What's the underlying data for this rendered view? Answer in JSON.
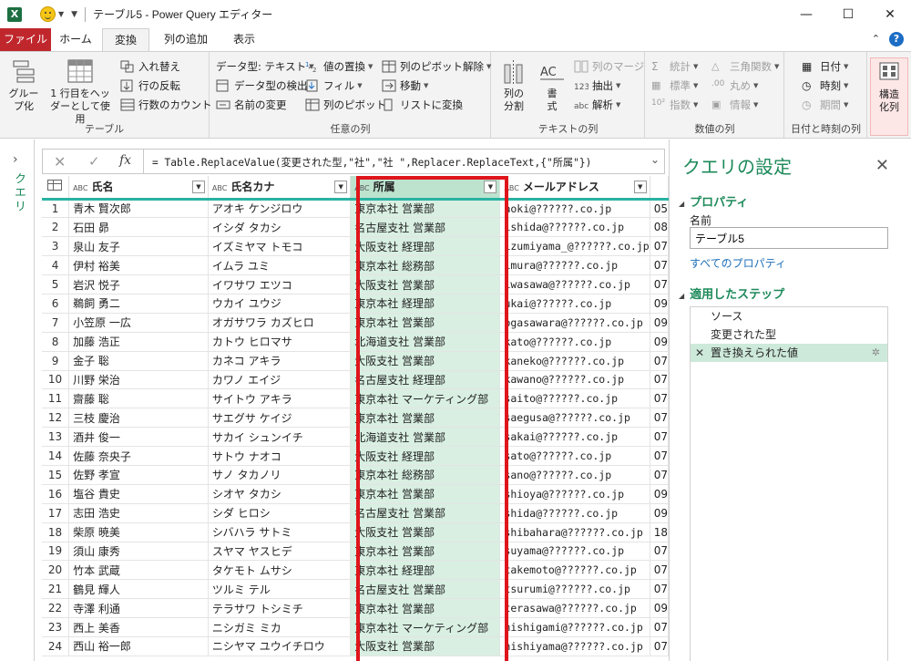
{
  "window": {
    "app_icon": "X",
    "title": "テーブル5 - Power Query エディター",
    "controls": [
      "—",
      "☐",
      "✕"
    ]
  },
  "ribbon_tabs": [
    "ファイル",
    "ホーム",
    "変換",
    "列の追加",
    "表示"
  ],
  "ribbon": {
    "table_group": {
      "label": "テーブル",
      "group_by_1": "グルー",
      "group_by_2": "プ化",
      "use_first_row_1": "1 行目をヘッ",
      "use_first_row_2": "ダーとして使用",
      "transpose": "入れ替え",
      "reverse_rows": "行の反転",
      "count_rows": "行数のカウント"
    },
    "any_column_group": {
      "label": "任意の列",
      "data_type": "データ型: テキスト",
      "detect_type": "データ型の検出",
      "rename": "名前の変更",
      "replace_values": "値の置換",
      "fill": "フィル",
      "pivot": "列のピボット",
      "unpivot": "列のピボット解除",
      "move": "移動",
      "to_list": "リストに変換"
    },
    "text_group": {
      "label": "テキストの列",
      "split_1": "列の",
      "split_2": "分割",
      "format_1": "書",
      "format_2": "式",
      "merge": "列のマージ",
      "extract": "抽出",
      "parse": "解析"
    },
    "number_group": {
      "label": "数値の列",
      "statistics": "統計",
      "standard": "標準",
      "scientific": "指数",
      "trig": "三角関数",
      "rounding": "丸め",
      "info": "情報"
    },
    "datetime_group": {
      "label": "日付と時刻の列",
      "date": "日付",
      "time": "時刻",
      "duration": "期間"
    },
    "structured_group": {
      "structured_1": "構造",
      "structured_2": "化列"
    }
  },
  "query_pane": {
    "label": "クエリ"
  },
  "formula_bar": {
    "cancel": "✕",
    "confirm": "✓",
    "fx": "fx",
    "formula": "= Table.ReplaceValue(変更された型,\"社\",\"社 \",Replacer.ReplaceText,{\"所属\"})"
  },
  "grid": {
    "type_label": "ABC",
    "columns": [
      "氏名",
      "氏名カナ",
      "所属",
      "メールアドレス",
      ""
    ],
    "rows": [
      [
        "1",
        "青木 賢次郎",
        "アオキ ケンジロウ",
        "東京本社 営業部",
        "aoki@??????.co.jp",
        "05"
      ],
      [
        "2",
        "石田 昴",
        "イシダ タカシ",
        "名古屋支社 営業部",
        "ishida@??????.co.jp",
        "08"
      ],
      [
        "3",
        "泉山 友子",
        "イズミヤマ トモコ",
        "大阪支社 経理部",
        "izumiyama_@??????.co.jp",
        "07"
      ],
      [
        "4",
        "伊村 裕美",
        "イムラ ユミ",
        "東京本社 総務部",
        "imura@??????.co.jp",
        "07"
      ],
      [
        "5",
        "岩沢 悦子",
        "イワサワ エツコ",
        "大阪支社 営業部",
        "iwasawa@??????.co.jp",
        "07"
      ],
      [
        "6",
        "鵜飼 勇二",
        "ウカイ ユウジ",
        "東京本社 経理部",
        "ukai@??????.co.jp",
        "09"
      ],
      [
        "7",
        "小笠原 一広",
        "オガサワラ カズヒロ",
        "東京本社 営業部",
        "ogasawara@??????.co.jp",
        "09"
      ],
      [
        "8",
        "加藤 浩正",
        "カトウ ヒロマサ",
        "北海道支社 営業部",
        "kato@??????.co.jp",
        "09"
      ],
      [
        "9",
        "金子 聡",
        "カネコ アキラ",
        "大阪支社 営業部",
        "kaneko@??????.co.jp",
        "07"
      ],
      [
        "10",
        "川野 栄治",
        "カワノ エイジ",
        "名古屋支社 経理部",
        "kawano@??????.co.jp",
        "07"
      ],
      [
        "11",
        "齋藤 聡",
        "サイトウ アキラ",
        "東京本社 マーケティング部",
        "saito@??????.co.jp",
        "07"
      ],
      [
        "12",
        "三枝 慶治",
        "サエグサ ケイジ",
        "東京本社 営業部",
        "saegusa@??????.co.jp",
        "07"
      ],
      [
        "13",
        "酒井 俊一",
        "サカイ シュンイチ",
        "北海道支社 営業部",
        "sakai@??????.co.jp",
        "07"
      ],
      [
        "14",
        "佐藤 奈央子",
        "サトウ ナオコ",
        "大阪支社 経理部",
        "sato@??????.co.jp",
        "07"
      ],
      [
        "15",
        "佐野 孝宣",
        "サノ タカノリ",
        "東京本社 総務部",
        "sano@??????.co.jp",
        "07"
      ],
      [
        "16",
        "塩谷 貴史",
        "シオヤ タカシ",
        "東京本社 営業部",
        "shioya@??????.co.jp",
        "09"
      ],
      [
        "17",
        "志田 浩史",
        "シダ ヒロシ",
        "名古屋支社 営業部",
        "shida@??????.co.jp",
        "09"
      ],
      [
        "18",
        "柴原 暁美",
        "シバハラ サトミ",
        "大阪支社 営業部",
        "shibahara@??????.co.jp",
        "18"
      ],
      [
        "19",
        "須山 康秀",
        "スヤマ ヤスヒデ",
        "東京本社 営業部",
        "suyama@??????.co.jp",
        "07"
      ],
      [
        "20",
        "竹本 武蔵",
        "タケモト ムサシ",
        "東京本社 経理部",
        "takemoto@??????.co.jp",
        "07"
      ],
      [
        "21",
        "鶴見 輝人",
        "ツルミ テル",
        "名古屋支社 営業部",
        "tsurumi@??????.co.jp",
        "07"
      ],
      [
        "22",
        "寺澤 利通",
        "テラサワ トシミチ",
        "東京本社 営業部",
        "terasawa@??????.co.jp",
        "09"
      ],
      [
        "23",
        "西上 美香",
        "ニシガミ ミカ",
        "東京本社 マーケティング部",
        "nishigami@??????.co.jp",
        "07"
      ],
      [
        "24",
        "西山 裕一郎",
        "ニシヤマ ユウイチロウ",
        "大阪支社 営業部",
        "nishiyama@??????.co.jp",
        "07"
      ]
    ]
  },
  "settings_pane": {
    "title": "クエリの設定",
    "properties_heading": "プロパティ",
    "name_label": "名前",
    "name_value": "テーブル5",
    "all_properties_link": "すべてのプロパティ",
    "steps_heading": "適用したステップ",
    "steps": [
      "ソース",
      "変更された型",
      "置き換えられた値"
    ]
  },
  "colors": {
    "file_tab": "#c0272d",
    "accent_green": "#1d8a5a",
    "selected_column": "#d8efe2",
    "highlight_box": "#e0141b"
  }
}
